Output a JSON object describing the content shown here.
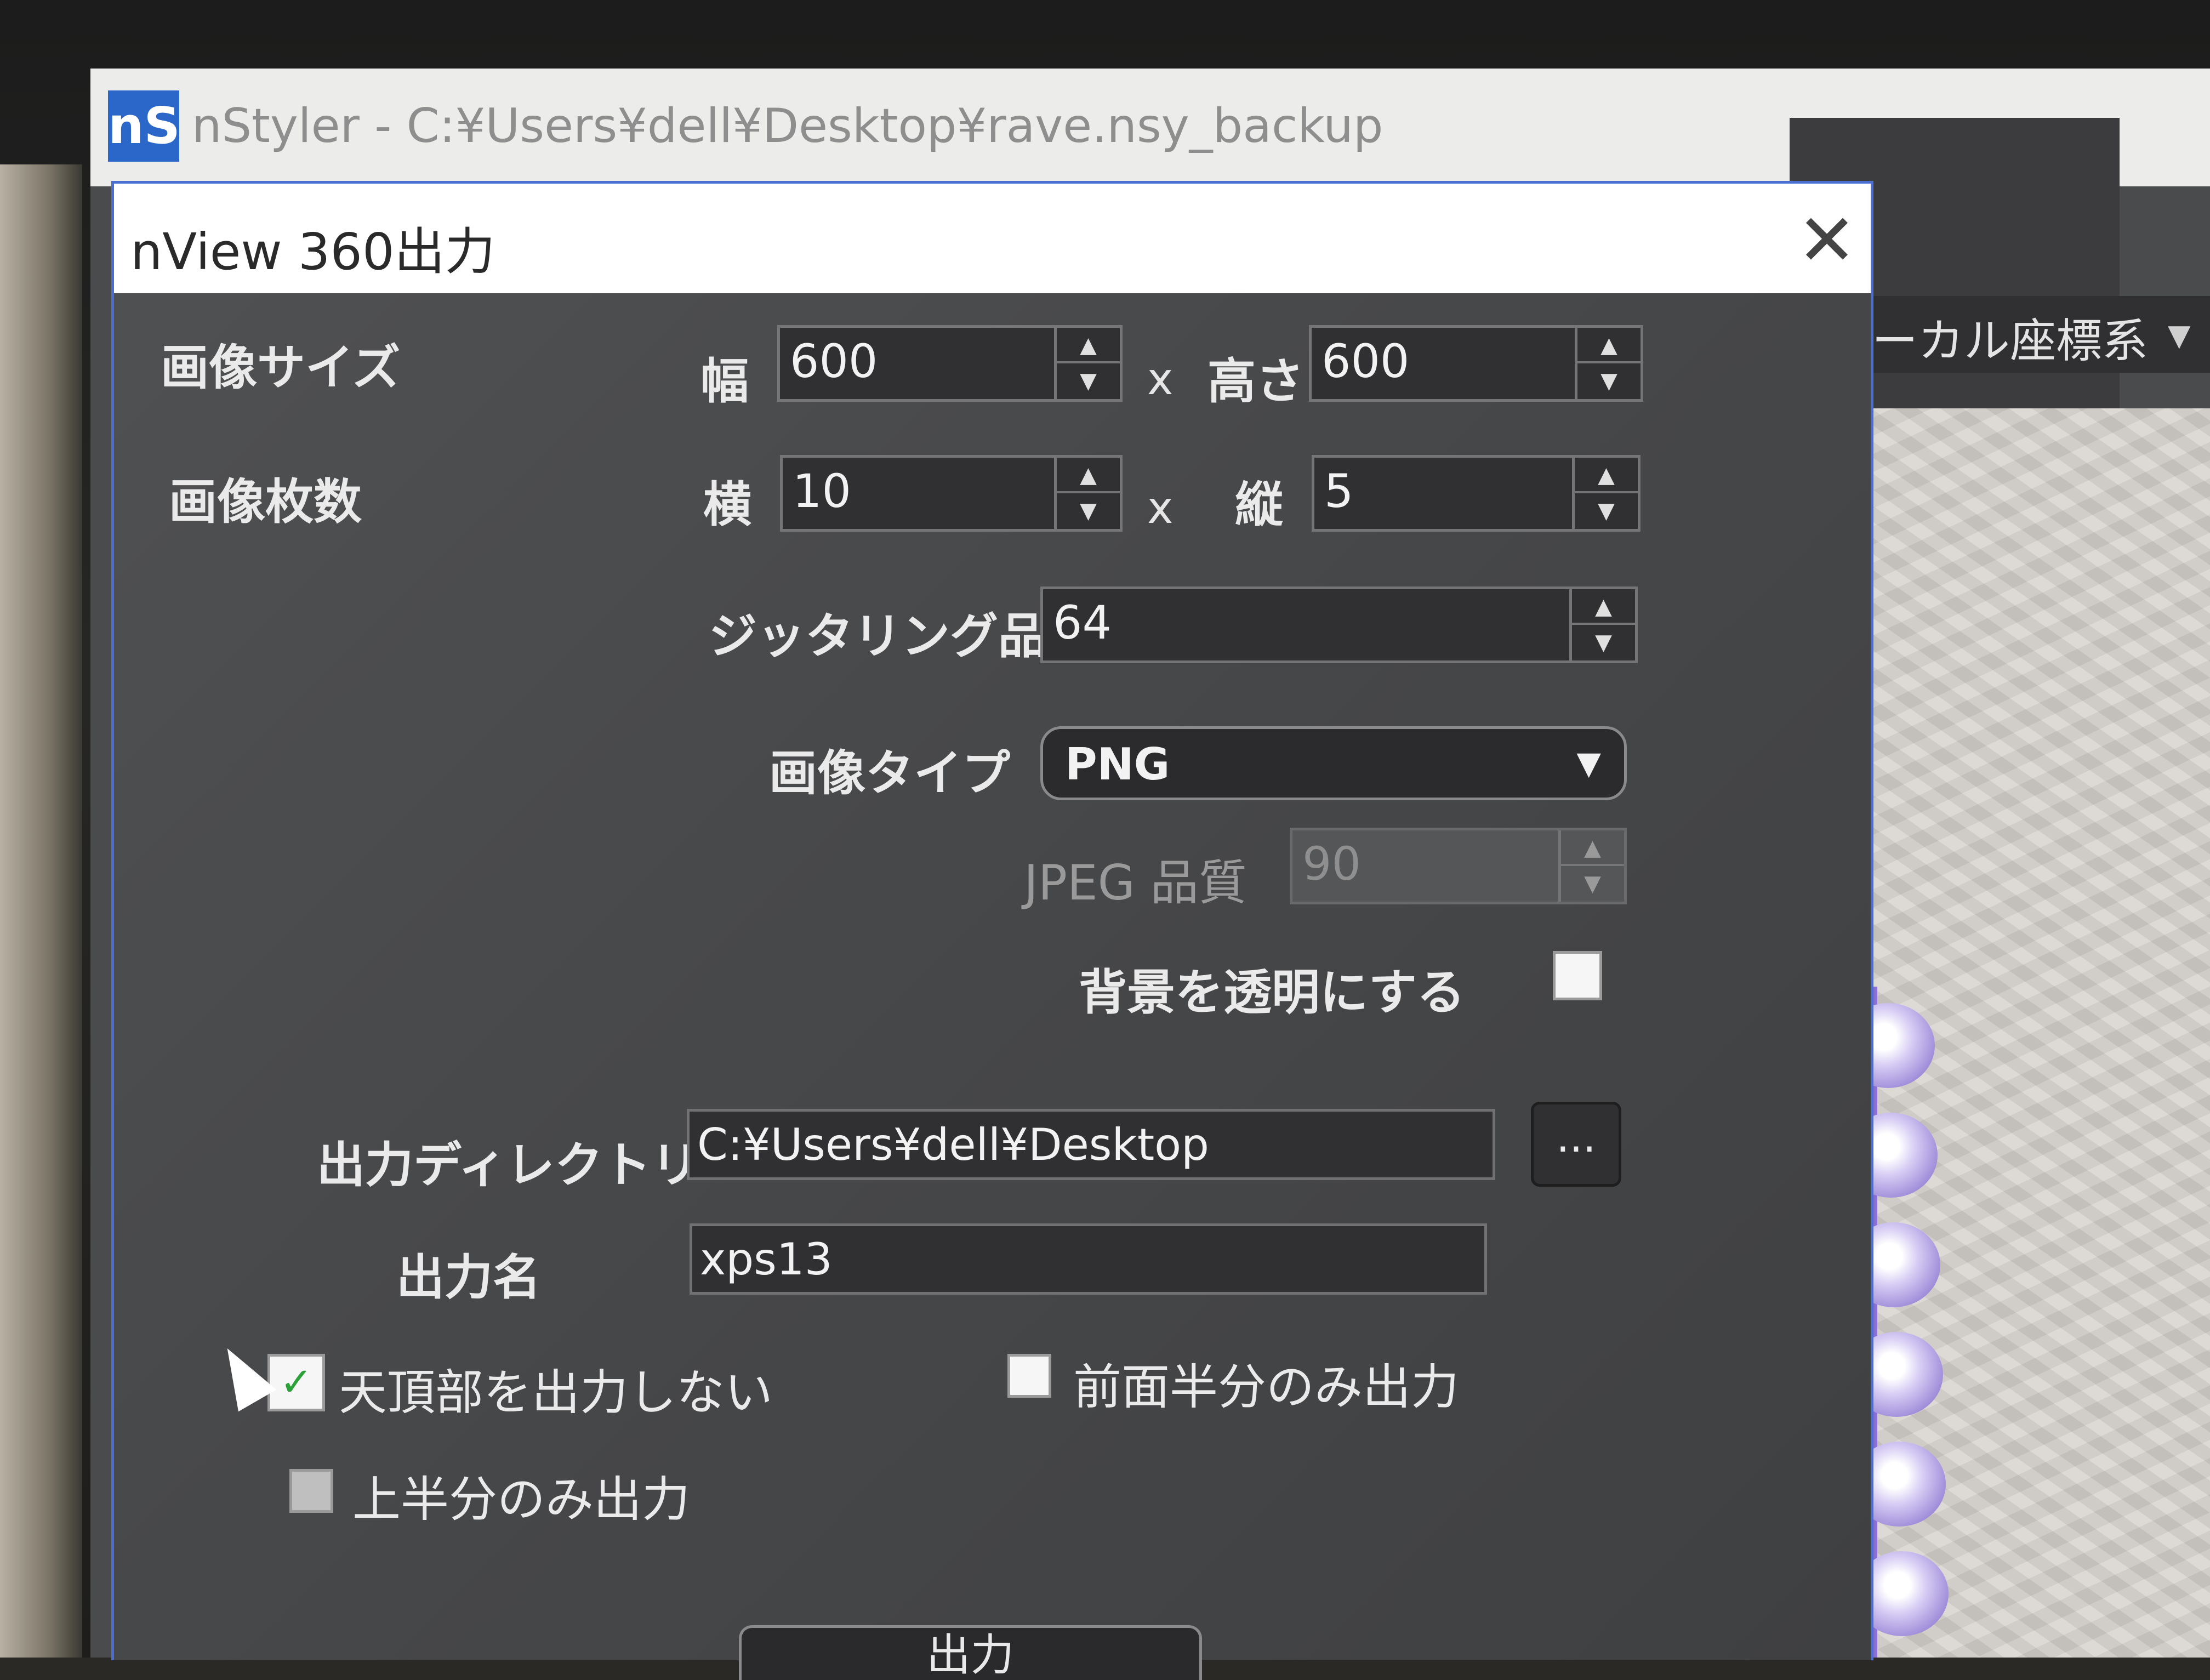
{
  "main_window": {
    "icon": "nS",
    "title": "nStyler - C:¥Users¥dell¥Desktop¥rave.nsy_backup",
    "coord_select_label": "ーカル座標系"
  },
  "dialog": {
    "title": "nView 360出力",
    "close_label": "✕",
    "image_size": {
      "label": "画像サイズ",
      "width_label": "幅",
      "width_value": "600",
      "x": "x",
      "height_label": "高さ",
      "height_value": "600"
    },
    "image_count": {
      "label": "画像枚数",
      "horizontal_label": "横",
      "horizontal_value": "10",
      "x": "x",
      "vertical_label": "縦",
      "vertical_value": "5"
    },
    "jittering": {
      "label": "ジッタリング品質",
      "value": "64"
    },
    "image_type": {
      "label": "画像タイプ",
      "value": "PNG"
    },
    "jpeg_quality": {
      "label": "JPEG 品質",
      "value": "90"
    },
    "transparent_bg": {
      "label": "背景を透明にする",
      "checked": false
    },
    "output_dir": {
      "label": "出力ディレクトリ",
      "value": "C:¥Users¥dell¥Desktop",
      "browse_label": "..."
    },
    "output_name": {
      "label": "出力名",
      "value": "xps13"
    },
    "options": {
      "no_top": {
        "label": "天頂部を出力しない",
        "checked": true
      },
      "front_half": {
        "label": "前面半分のみ出力",
        "checked": false
      },
      "upper_half": {
        "label": "上半分のみ出力",
        "checked": false
      }
    },
    "ok_label": "出力"
  }
}
